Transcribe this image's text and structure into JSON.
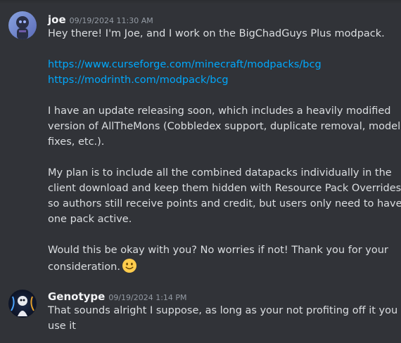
{
  "messages": [
    {
      "username": "joe",
      "timestamp": "09/19/2024 11:30 AM",
      "lines": [
        "Hey there! I'm Joe, and I work on the BigChadGuys Plus modpack.",
        "https://www.curseforge.com/minecraft/modpacks/bcg",
        "https://modrinth.com/modpack/bcg",
        "I have an update releasing soon, which includes a heavily modified",
        "version of AllTheMons (Cobbledex support, duplicate removal, model",
        "fixes, etc.).",
        "My plan is to include all the combined datapacks individually in the",
        "client download and keep them hidden with Resource Pack Overrides,",
        "so authors still receive points and credit, but users only need to have",
        "one pack active.",
        "Would this be okay with you? No worries if not! Thank you for your",
        "consideration."
      ],
      "emoji": "slightly-smiling-face-emoji"
    },
    {
      "username": "Genotype",
      "timestamp": "09/19/2024 1:14 PM",
      "lines": [
        "That sounds alright I suppose, as long as your not profiting off it you can",
        "use it"
      ]
    }
  ],
  "colors": {
    "background": "#313338",
    "text": "#dbdee1",
    "username": "#f2f3f5",
    "timestamp": "#949ba4",
    "link": "#00a8fc"
  }
}
